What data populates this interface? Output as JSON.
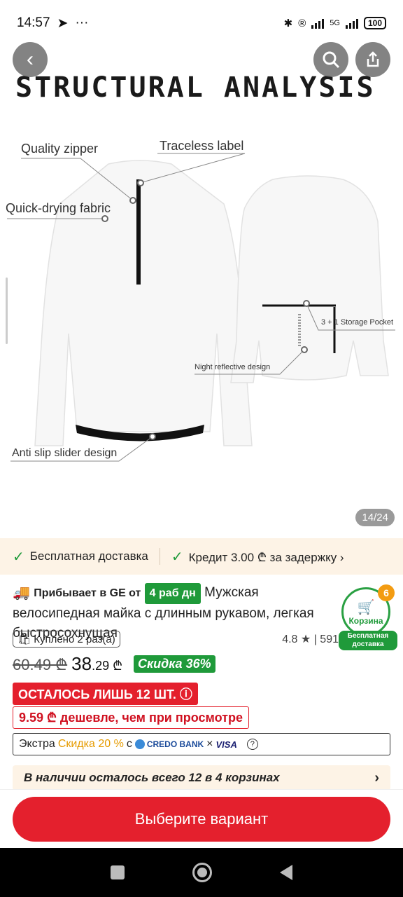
{
  "status_bar": {
    "time": "14:57",
    "extra": "···",
    "battery": "100",
    "network": "5G"
  },
  "hero": {
    "title": "STRUCTURAL ANALYSIS",
    "callouts": {
      "quality_zipper": "Quality zipper",
      "traceless_label": "Traceless label",
      "quick_drying": "Quick-drying fabric",
      "storage_pocket": "3 + 1 Storage Pocket",
      "night_reflective": "Night reflective design",
      "anti_slip": "Anti slip slider design"
    },
    "image_counter": "14/24"
  },
  "benefits": {
    "free_delivery": "Бесплатная доставка",
    "credit": "Кредит 3.00 ₾ за задержку ›"
  },
  "product": {
    "arrival_label": "Прибывает в GE от",
    "days_badge": "4 раб дн",
    "title": "Мужская велосипедная майка с длинным рукавом, легкая быстросохнущая",
    "bought": "Куплено 2 раз(а)",
    "rating": "4.8",
    "reviews": "591",
    "old_price": "60.49 ₾",
    "new_price_main": "38",
    "new_price_decimal": ".29 ₾",
    "discount": "Скидка 36%",
    "stock_warning": "ОСТАЛОСЬ ЛИШЬ 12 ШТ.",
    "cheaper": "9.59 ₾ дешевле, чем при просмотре",
    "extra_prefix": "Экстра",
    "extra_discount": "Скидка 20 %",
    "extra_with": "с",
    "bank": "CREDO BANK",
    "times": "×",
    "card": "VISA",
    "stock_banner": "В наличии осталось всего 12 в 4 корзинах"
  },
  "cart": {
    "label": "Корзина",
    "count": "6",
    "free_ship": "Бесплатная доставка"
  },
  "cta": {
    "label": "Выберите вариант"
  }
}
